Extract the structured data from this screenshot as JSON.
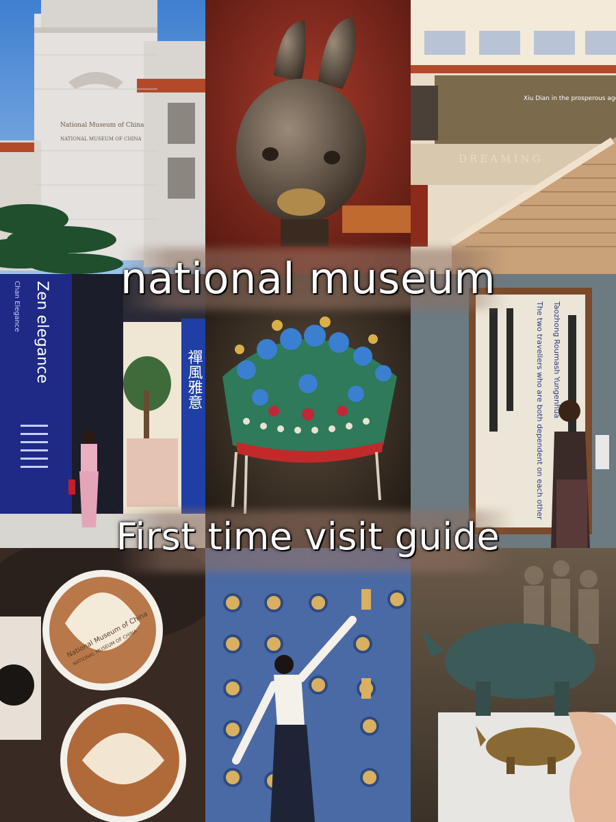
{
  "overlay": {
    "title": "national museum",
    "subtitle": "First time visit guide"
  },
  "tiles": {
    "building": {
      "sign_line_1": "National Museum of China",
      "sign_line_2": "NATIONAL MUSEUM OF CHINA"
    },
    "rabbit_head": {},
    "staircase_hall": {
      "banner_title": "Xiu Dian in the prosperous age",
      "banner_word": "DREAMING"
    },
    "zen_exhibit": {
      "poster_title": "Zen elegance",
      "poster_sub": "Chan Elegance",
      "vertical_cn": "禪風雅意"
    },
    "phoenix_crown": {},
    "calligraphy": {
      "caption_1": "Taozhong Roumash Yungenhua",
      "caption_2": "The two travellers who are both dependent on each other"
    },
    "latte": {
      "foam_text_1": "National Museum of China",
      "foam_text_2": "NATIONAL MUSEUM OF CHINA"
    },
    "coin_wall": {},
    "bronze_rhino": {}
  },
  "colors": {
    "sky": "#5b8fd0",
    "exhibit_blue": "#1f2a86",
    "wall_coin": "#4a6aa6",
    "rhino": "#3c5a58"
  }
}
